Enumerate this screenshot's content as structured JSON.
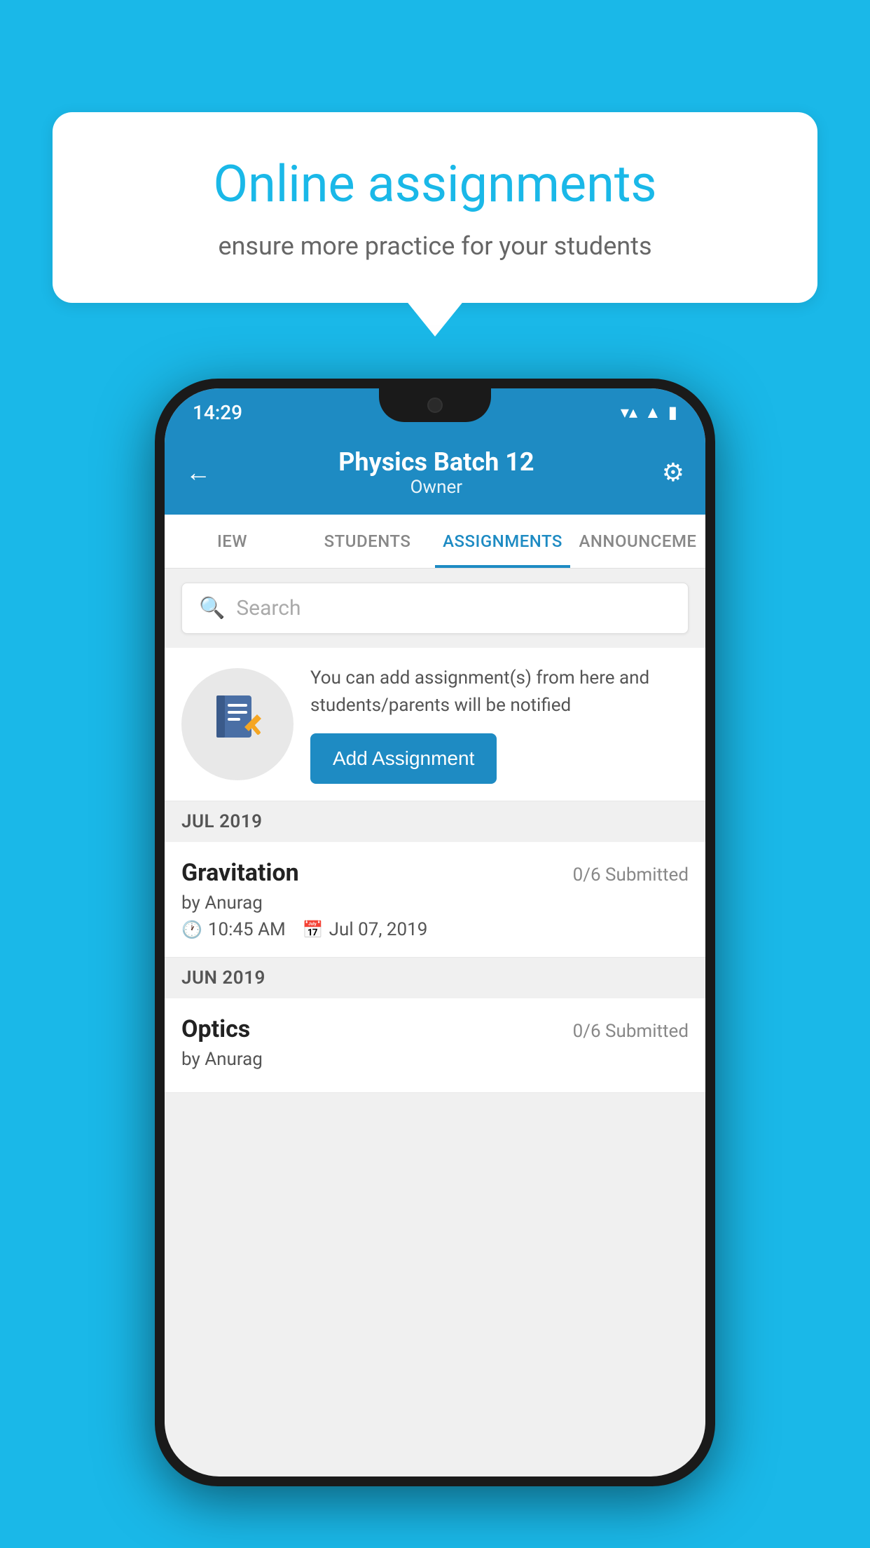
{
  "background": {
    "color": "#1ab8e8"
  },
  "speech_bubble": {
    "title": "Online assignments",
    "subtitle": "ensure more practice for your students"
  },
  "phone": {
    "status_bar": {
      "time": "14:29",
      "wifi_icon": "▼",
      "signal_icon": "▲",
      "battery_icon": "▮"
    },
    "header": {
      "back_icon": "←",
      "title": "Physics Batch 12",
      "subtitle": "Owner",
      "settings_icon": "⚙"
    },
    "tabs": [
      {
        "label": "IEW",
        "active": false
      },
      {
        "label": "STUDENTS",
        "active": false
      },
      {
        "label": "ASSIGNMENTS",
        "active": true
      },
      {
        "label": "ANNOUNCEME",
        "active": false
      }
    ],
    "search": {
      "placeholder": "Search",
      "icon": "🔍"
    },
    "promo": {
      "description": "You can add assignment(s) from here and students/parents will be notified",
      "button_label": "Add Assignment"
    },
    "sections": [
      {
        "label": "JUL 2019",
        "assignments": [
          {
            "name": "Gravitation",
            "submitted": "0/6 Submitted",
            "author": "by Anurag",
            "time": "10:45 AM",
            "date": "Jul 07, 2019"
          }
        ]
      },
      {
        "label": "JUN 2019",
        "assignments": [
          {
            "name": "Optics",
            "submitted": "0/6 Submitted",
            "author": "by Anurag",
            "time": "",
            "date": ""
          }
        ]
      }
    ]
  }
}
